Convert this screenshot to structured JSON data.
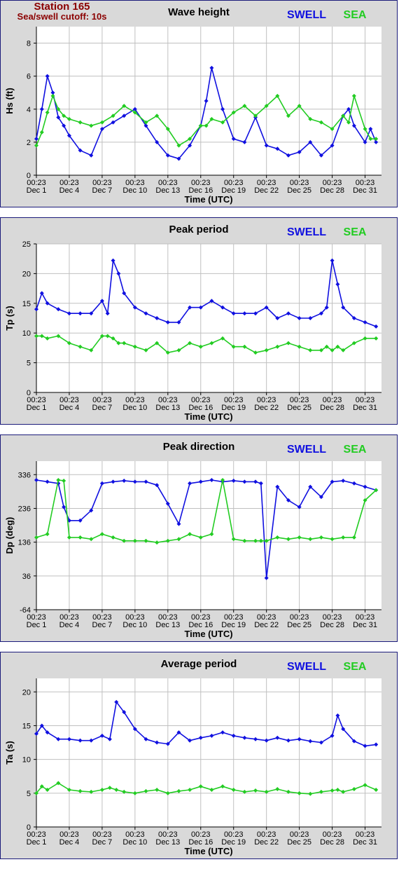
{
  "header": {
    "station": "Station 165",
    "cutoff": "Sea/swell cutoff: 10s"
  },
  "legend": {
    "swell": "SWELL",
    "sea": "SEA"
  },
  "colors": {
    "swell": "#1010e0",
    "sea": "#22cc22",
    "panel": "#d9d9d9",
    "plot": "#ffffff",
    "grid": "#c0c0c0",
    "header": "#8b0000"
  },
  "x_ticks": [
    {
      "time": "00:23",
      "date": "Dec 1"
    },
    {
      "time": "00:23",
      "date": "Dec 4"
    },
    {
      "time": "00:23",
      "date": "Dec 7"
    },
    {
      "time": "00:23",
      "date": "Dec 10"
    },
    {
      "time": "00:23",
      "date": "Dec 13"
    },
    {
      "time": "00:23",
      "date": "Dec 16"
    },
    {
      "time": "00:23",
      "date": "Dec 19"
    },
    {
      "time": "00:23",
      "date": "Dec 22"
    },
    {
      "time": "00:23",
      "date": "Dec 25"
    },
    {
      "time": "00:23",
      "date": "Dec 28"
    },
    {
      "time": "00:23",
      "date": "Dec 31"
    }
  ],
  "chart_data": [
    {
      "type": "line",
      "title": "Wave height",
      "xlabel": "Time (UTC)",
      "ylabel": "Hs (ft)",
      "ylim": [
        0,
        9
      ],
      "yticks": [
        0,
        2,
        4,
        6,
        8
      ],
      "grid": true,
      "legend_position": "top-right",
      "x": [
        1,
        1.5,
        2,
        2.5,
        3,
        3.5,
        4,
        5,
        6,
        7,
        8,
        9,
        10,
        11,
        12,
        13,
        14,
        15,
        16,
        16.5,
        17,
        18,
        19,
        20,
        21,
        22,
        23,
        24,
        25,
        26,
        27,
        28,
        29,
        29.5,
        30,
        31,
        31.5,
        32
      ],
      "series": [
        {
          "name": "SWELL",
          "values": [
            2.2,
            4.0,
            6.0,
            5.0,
            3.5,
            3.0,
            2.4,
            1.5,
            1.2,
            2.8,
            3.2,
            3.6,
            4.0,
            3.0,
            2.0,
            1.2,
            1.0,
            1.8,
            3.0,
            4.5,
            6.5,
            4.0,
            2.2,
            2.0,
            3.5,
            1.8,
            1.6,
            1.2,
            1.4,
            2.0,
            1.2,
            1.8,
            3.6,
            4.0,
            3.0,
            2.0,
            2.8,
            2.0
          ]
        },
        {
          "name": "SEA",
          "values": [
            1.8,
            2.6,
            3.8,
            4.8,
            4.0,
            3.6,
            3.4,
            3.2,
            3.0,
            3.2,
            3.6,
            4.2,
            3.8,
            3.2,
            3.6,
            2.8,
            1.8,
            2.2,
            3.0,
            3.0,
            3.4,
            3.2,
            3.8,
            4.2,
            3.6,
            4.2,
            4.8,
            3.6,
            4.2,
            3.4,
            3.2,
            2.8,
            3.6,
            3.2,
            4.8,
            2.8,
            2.2,
            2.2
          ]
        }
      ]
    },
    {
      "type": "line",
      "title": "Peak period",
      "xlabel": "Time (UTC)",
      "ylabel": "Tp (s)",
      "ylim": [
        0,
        25
      ],
      "yticks": [
        0,
        5,
        10,
        15,
        20,
        25
      ],
      "grid": true,
      "legend_position": "top-right",
      "x": [
        1,
        1.5,
        2,
        3,
        4,
        5,
        6,
        7,
        7.5,
        8,
        8.5,
        9,
        10,
        11,
        12,
        13,
        14,
        15,
        16,
        17,
        18,
        19,
        20,
        21,
        22,
        23,
        24,
        25,
        26,
        27,
        27.5,
        28,
        28.5,
        29,
        30,
        31,
        32
      ],
      "series": [
        {
          "name": "SWELL",
          "values": [
            14,
            16.7,
            15,
            14,
            13.3,
            13.3,
            13.3,
            15.4,
            13.3,
            22.2,
            20,
            16.7,
            14.3,
            13.3,
            12.5,
            11.8,
            11.8,
            14.3,
            14.3,
            15.4,
            14.3,
            13.3,
            13.3,
            13.3,
            14.3,
            12.5,
            13.3,
            12.5,
            12.5,
            13.3,
            14.3,
            22.2,
            18.2,
            14.3,
            12.5,
            11.8,
            11.1
          ]
        },
        {
          "name": "SEA",
          "values": [
            9.5,
            9.5,
            9.1,
            9.5,
            8.3,
            7.7,
            7.1,
            9.5,
            9.5,
            9.1,
            8.3,
            8.3,
            7.7,
            7.1,
            8.3,
            6.7,
            7.1,
            8.3,
            7.7,
            8.3,
            9.1,
            7.7,
            7.7,
            6.7,
            7.1,
            7.7,
            8.3,
            7.7,
            7.1,
            7.1,
            7.7,
            7.1,
            7.7,
            7.1,
            8.3,
            9.1,
            9.1
          ]
        }
      ]
    },
    {
      "type": "line",
      "title": "Peak direction",
      "xlabel": "Time (UTC)",
      "ylabel": "Dp (deg)",
      "ylim": [
        -64,
        376
      ],
      "yticks": [
        -64,
        36,
        136,
        236,
        336
      ],
      "grid": true,
      "legend_position": "top-right",
      "x": [
        1,
        2,
        3,
        3.5,
        4,
        5,
        6,
        7,
        8,
        9,
        10,
        11,
        12,
        13,
        14,
        15,
        16,
        17,
        18,
        19,
        20,
        21,
        21.5,
        22,
        23,
        24,
        25,
        26,
        27,
        28,
        29,
        30,
        31,
        32
      ],
      "series": [
        {
          "name": "SWELL",
          "values": [
            320,
            315,
            310,
            240,
            200,
            200,
            230,
            310,
            315,
            318,
            315,
            315,
            305,
            250,
            190,
            310,
            315,
            320,
            315,
            318,
            315,
            315,
            310,
            30,
            300,
            260,
            240,
            300,
            270,
            315,
            318,
            310,
            300,
            290
          ]
        },
        {
          "name": "SEA",
          "values": [
            150,
            160,
            320,
            318,
            150,
            150,
            145,
            160,
            150,
            140,
            140,
            140,
            135,
            140,
            145,
            160,
            150,
            160,
            320,
            145,
            140,
            140,
            140,
            140,
            150,
            145,
            150,
            145,
            150,
            145,
            150,
            150,
            260,
            290
          ]
        }
      ]
    },
    {
      "type": "line",
      "title": "Average period",
      "xlabel": "Time (UTC)",
      "ylabel": "Ta (s)",
      "ylim": [
        0,
        22
      ],
      "yticks": [
        0,
        5,
        10,
        15,
        20
      ],
      "grid": true,
      "legend_position": "top-right",
      "x": [
        1,
        1.5,
        2,
        3,
        4,
        5,
        6,
        7,
        7.7,
        8.3,
        9,
        10,
        11,
        12,
        13,
        14,
        15,
        16,
        17,
        18,
        19,
        20,
        21,
        22,
        23,
        24,
        25,
        26,
        27,
        28,
        28.5,
        29,
        30,
        31,
        32
      ],
      "series": [
        {
          "name": "SWELL",
          "values": [
            13.8,
            15,
            14,
            13,
            13,
            12.8,
            12.8,
            13.5,
            13,
            18.5,
            17,
            14.5,
            13,
            12.5,
            12.3,
            14,
            12.8,
            13.2,
            13.5,
            14,
            13.5,
            13.2,
            13,
            12.8,
            13.2,
            12.8,
            13,
            12.7,
            12.5,
            13.5,
            16.5,
            14.5,
            12.7,
            12,
            12.2
          ]
        },
        {
          "name": "SEA",
          "values": [
            5,
            6,
            5.5,
            6.5,
            5.5,
            5.3,
            5.2,
            5.5,
            5.8,
            5.5,
            5.2,
            5,
            5.3,
            5.5,
            5,
            5.3,
            5.5,
            6,
            5.5,
            6,
            5.5,
            5.2,
            5.4,
            5.2,
            5.6,
            5.2,
            5,
            4.9,
            5.2,
            5.4,
            5.5,
            5.2,
            5.6,
            6.2,
            5.5
          ]
        }
      ]
    }
  ]
}
